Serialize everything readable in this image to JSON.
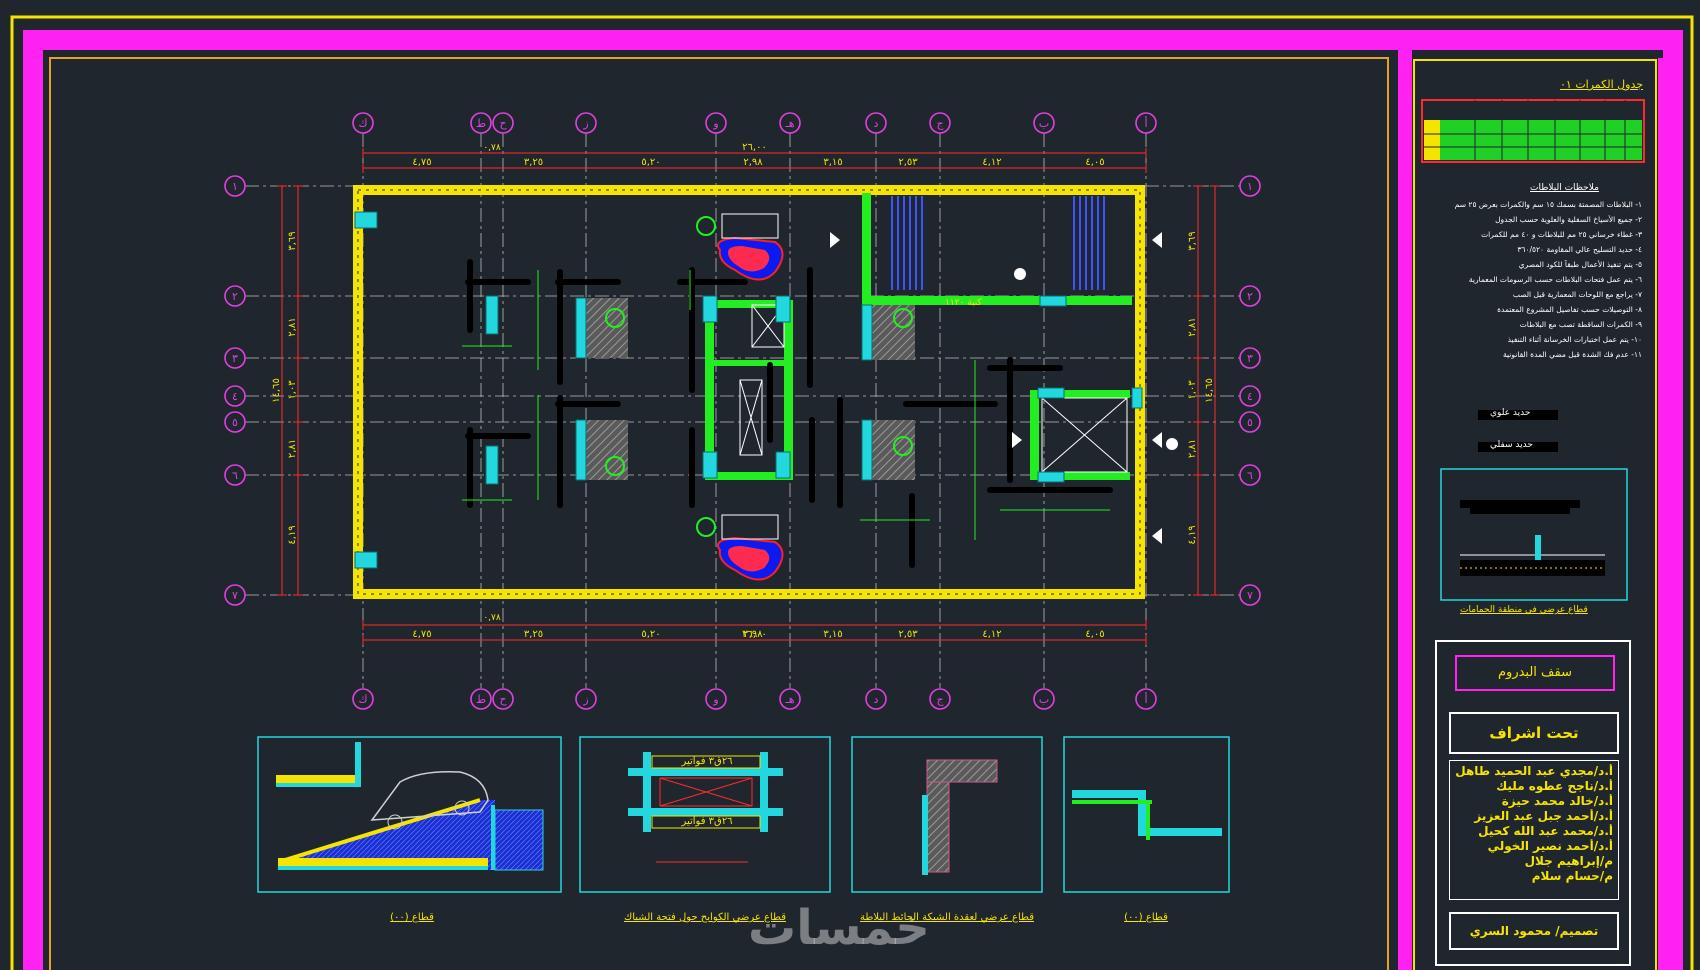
{
  "drawing": {
    "grid_columns_top": [
      "أ",
      "ب",
      "ج",
      "د",
      "هـ",
      "و",
      "ز",
      "ح",
      "ط",
      "ك"
    ],
    "grid_rows": [
      "١",
      "٢",
      "٣",
      "٤",
      "٥",
      "٦",
      "٧"
    ],
    "top_total_dim": "٢٦,٠٠",
    "top_dims": [
      "٤,٠٥",
      "٤,١٢",
      "٢,٥٣",
      "٣,١٥",
      "٢,٩٨",
      "٥,٢٠",
      "٣,٢٥",
      "٤,٧٥"
    ],
    "left_total_dim": "١٤,٦٥",
    "left_dims": [
      "٣,٦٩",
      "٢,٨١",
      "١,٠٣",
      "٢,٨١",
      "٤,١٩"
    ],
    "small_end_dim": "٠,٧٨",
    "fixture_label": "كنبة ١١٢٠"
  },
  "sections": [
    {
      "caption": "قطاع (٠٠)"
    },
    {
      "caption": "قطاع عرضي الكوابح حول فتحة الشباك",
      "label_top": "٢٦ق٣ فواتير",
      "label_bottom": "٢٦ق٣ فواتير"
    },
    {
      "caption": "قطاع عرضي لعقدة الشبكة الحائط البلاطة"
    },
    {
      "caption": "قطاع (٠٠)"
    }
  ],
  "right_panel": {
    "table_title": "جدول الكمرات ٠١",
    "notes_title": "ملاحظات البلاطات",
    "notes": [
      "١- البلاطات المصمتة بسمك ١٥ سم والكمرات بعرض ٢٥ سم",
      "٢- جميع الأسياخ السفلية والعلوية حسب الجدول",
      "٣- غطاء خرساني ٢٥ مم للبلاطات و ٤٠ مم للكمرات",
      "٤- حديد التسليح عالي المقاومة ٣٦٠/٥٢٠",
      "٥- يتم تنفيذ الأعمال طبقاً للكود المصري",
      "٦- يتم عمل فتحات البلاطات حسب الرسومات المعمارية",
      "٧- يراجع مع اللوحات المعمارية قبل الصب",
      "٨- التوصيلات حسب تفاصيل المشروع المعتمدة",
      "٩- الكمرات الساقطة تصب مع البلاطات",
      "١٠- يتم عمل اختبارات الخرسانة أثناء التنفيذ",
      "١١- عدم فك الشدة قبل مضي المدة القانونية"
    ],
    "legend": [
      "حديد علوي",
      "حديد سفلي"
    ],
    "detail_caption": "قطاع عرضي في منطقة الحمامات",
    "title_block": {
      "sheet_title": "سقف البدروم",
      "supervision": "تحت اشراف",
      "names": [
        "أ.د/مجدي عبد الحميد طاهل",
        "أ.د/ناجح عطوه مليك",
        "أ.د/خالد محمد حيزة",
        "أ.د/أحمد جبل عبد العزيز",
        "أ.د/محمد عبد الله كحيل",
        "أ.د/أحمد نصير الخولي",
        "م/إبراهيم جلال",
        "م/حسام سلام"
      ],
      "designer": "تصميم/ محمود السري"
    }
  },
  "watermark": "خمسات",
  "colors": {
    "background": "#20262e",
    "border_magenta": "#ff22f2",
    "border_yellow": "#f5e400",
    "grid_bubble": "#e040e0",
    "dimension": "#ff2b2b",
    "beam_green": "#22ee22",
    "cyan": "#22d7dd"
  }
}
